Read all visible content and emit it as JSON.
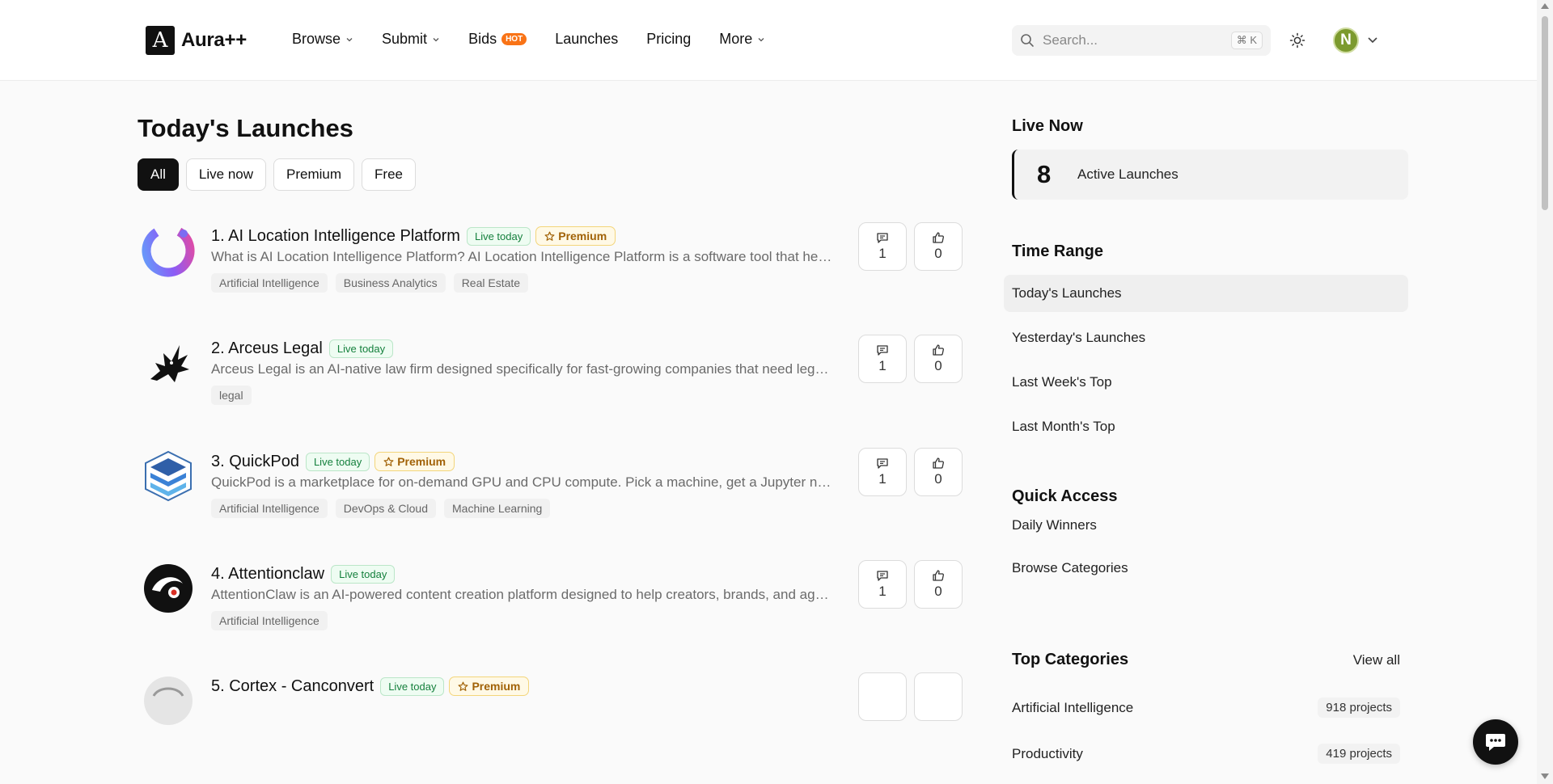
{
  "header": {
    "brand_name": "Aura++",
    "logo_letter": "A",
    "nav": [
      {
        "label": "Browse",
        "has_dropdown": true
      },
      {
        "label": "Submit",
        "has_dropdown": true
      },
      {
        "label": "Bids",
        "badge": "HOT"
      },
      {
        "label": "Launches"
      },
      {
        "label": "Pricing"
      },
      {
        "label": "More",
        "has_dropdown": true
      }
    ],
    "search_placeholder": "Search...",
    "search_shortcut": "⌘ K",
    "avatar_initial": "N"
  },
  "main": {
    "title": "Today's Launches",
    "filters": [
      "All",
      "Live now",
      "Premium",
      "Free"
    ],
    "active_filter": "All",
    "launches": [
      {
        "title": "1. AI Location Intelligence Platform",
        "live_badge": "Live today",
        "premium_badge": "Premium",
        "description": "What is AI Location Intelligence Platform? AI Location Intelligence Platform is a software tool that helps businesses analyze location data",
        "tags": [
          "Artificial Intelligence",
          "Business Analytics",
          "Real Estate"
        ],
        "comments": "1",
        "upvotes": "0"
      },
      {
        "title": "2. Arceus Legal",
        "live_badge": "Live today",
        "description": "Arceus Legal is an AI-native law firm designed specifically for fast-growing companies that need legal work done",
        "tags": [
          "legal"
        ],
        "comments": "1",
        "upvotes": "0"
      },
      {
        "title": "3. QuickPod",
        "live_badge": "Live today",
        "premium_badge": "Premium",
        "description": "QuickPod is a marketplace for on-demand GPU and CPU compute. Pick a machine, get a Jupyter notebook",
        "tags": [
          "Artificial Intelligence",
          "DevOps & Cloud",
          "Machine Learning"
        ],
        "comments": "1",
        "upvotes": "0"
      },
      {
        "title": "4. Attentionclaw",
        "live_badge": "Live today",
        "description": "AttentionClaw is an AI-powered content creation platform designed to help creators, brands, and agencies",
        "tags": [
          "Artificial Intelligence"
        ],
        "comments": "1",
        "upvotes": "0"
      },
      {
        "title": "5. Cortex - Canconvert",
        "live_badge": "Live today",
        "premium_badge": "Premium",
        "description": "",
        "tags": [],
        "comments": "",
        "upvotes": ""
      }
    ]
  },
  "sidebar": {
    "live_now_heading": "Live Now",
    "active_count": "8",
    "active_label": "Active Launches",
    "time_range_heading": "Time Range",
    "time_ranges": [
      "Today's Launches",
      "Yesterday's Launches",
      "Last Week's Top",
      "Last Month's Top"
    ],
    "active_time_range": "Today's Launches",
    "quick_access_heading": "Quick Access",
    "quick_access": [
      "Daily Winners",
      "Browse Categories"
    ],
    "top_categories_heading": "Top Categories",
    "view_all": "View all",
    "categories": [
      {
        "name": "Artificial Intelligence",
        "count": "918 projects"
      },
      {
        "name": "Productivity",
        "count": "419 projects"
      }
    ]
  },
  "colors": {
    "accent": "#111111",
    "hot_badge": "#f97316",
    "live_green": "#15803d",
    "premium_gold": "#a16207",
    "avatar": "#7c9a2e"
  }
}
